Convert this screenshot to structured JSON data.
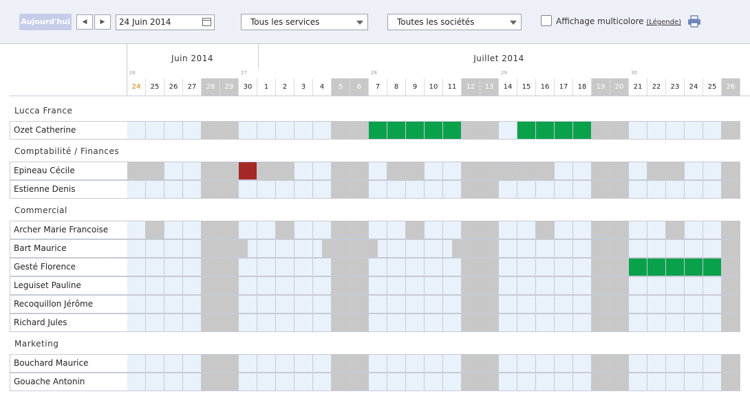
{
  "toolbar": {
    "today_label": "Aujourd'hui",
    "date_value": "24 Juin 2014",
    "services_value": "Tous les services",
    "societes_value": "Toutes les sociétés",
    "multicolor_label": "Affichage multicolore",
    "legend_link": "(Légende)"
  },
  "months": [
    {
      "label": "Juin 2014",
      "start": 0,
      "end": 7
    },
    {
      "label": "Juillet 2014",
      "start": 7,
      "end": 33
    }
  ],
  "weeks": [
    "26",
    "27",
    "28",
    "29",
    "30"
  ],
  "days": [
    {
      "d": "24",
      "we": false,
      "today": true
    },
    {
      "d": "25",
      "we": false
    },
    {
      "d": "26",
      "we": false
    },
    {
      "d": "27",
      "we": false
    },
    {
      "d": "28",
      "we": true
    },
    {
      "d": "29",
      "we": true
    },
    {
      "d": "30",
      "we": false
    },
    {
      "d": "1",
      "we": false
    },
    {
      "d": "2",
      "we": false
    },
    {
      "d": "3",
      "we": false
    },
    {
      "d": "4",
      "we": false
    },
    {
      "d": "5",
      "we": true
    },
    {
      "d": "6",
      "we": true
    },
    {
      "d": "7",
      "we": false
    },
    {
      "d": "8",
      "we": false
    },
    {
      "d": "9",
      "we": false
    },
    {
      "d": "10",
      "we": false
    },
    {
      "d": "11",
      "we": false
    },
    {
      "d": "12",
      "we": true
    },
    {
      "d": "13",
      "we": true
    },
    {
      "d": "14",
      "we": false
    },
    {
      "d": "15",
      "we": false
    },
    {
      "d": "16",
      "we": false
    },
    {
      "d": "17",
      "we": false
    },
    {
      "d": "18",
      "we": false
    },
    {
      "d": "19",
      "we": true
    },
    {
      "d": "20",
      "we": true
    },
    {
      "d": "21",
      "we": false
    },
    {
      "d": "22",
      "we": false
    },
    {
      "d": "23",
      "we": false
    },
    {
      "d": "24",
      "we": false
    },
    {
      "d": "25",
      "we": false
    },
    {
      "d": "26",
      "we": true
    }
  ],
  "groups": [
    {
      "title": "Lucca France",
      "employees": [
        {
          "name": "Ozet Catherine",
          "green": [
            13,
            14,
            15,
            16,
            17,
            21,
            22,
            23,
            24
          ],
          "red": [],
          "off": [],
          "halfoff": [],
          "halfoffR": []
        }
      ]
    },
    {
      "title": "Comptabilité / Finances",
      "employees": [
        {
          "name": "Epineau Cécile",
          "green": [],
          "red": [
            6
          ],
          "off": [
            0,
            1,
            7,
            8,
            14,
            15,
            20,
            21,
            22,
            28,
            29
          ],
          "halfoff": [],
          "halfoffR": []
        },
        {
          "name": "Estienne Denis",
          "green": [],
          "red": [],
          "off": [],
          "halfoff": [],
          "halfoffR": []
        }
      ]
    },
    {
      "title": "Commercial",
      "employees": [
        {
          "name": "Archer Marie Francoise",
          "green": [],
          "red": [],
          "off": [
            1,
            8,
            15,
            22,
            29
          ],
          "halfoff": [],
          "halfoffR": []
        },
        {
          "name": "Bart Maurice",
          "green": [],
          "red": [],
          "off": [],
          "halfoff": [
            6,
            13,
            25
          ],
          "halfoffR": [
            10,
            17
          ]
        },
        {
          "name": "Gesté Florence",
          "green": [
            27,
            28,
            29,
            30,
            31
          ],
          "red": [],
          "off": [],
          "halfoff": [],
          "halfoffR": []
        },
        {
          "name": "Leguiset Pauline",
          "green": [],
          "red": [],
          "off": [],
          "halfoff": [],
          "halfoffR": []
        },
        {
          "name": "Recoquillon Jérôme",
          "green": [],
          "red": [],
          "off": [],
          "halfoff": [],
          "halfoffR": []
        },
        {
          "name": "Richard Jules",
          "green": [],
          "red": [],
          "off": [],
          "halfoff": [],
          "halfoffR": []
        }
      ]
    },
    {
      "title": "Marketing",
      "employees": [
        {
          "name": "Bouchard Maurice",
          "green": [],
          "red": [],
          "off": [],
          "halfoff": [],
          "halfoffR": []
        },
        {
          "name": "Gouache Antonin",
          "green": [],
          "red": [],
          "off": [],
          "halfoff": [],
          "halfoffR": []
        }
      ]
    }
  ],
  "colors": {
    "green": "#0aa14b",
    "red": "#a52828",
    "weekend": "#c8c8c8",
    "free": "#e9f1fa"
  }
}
